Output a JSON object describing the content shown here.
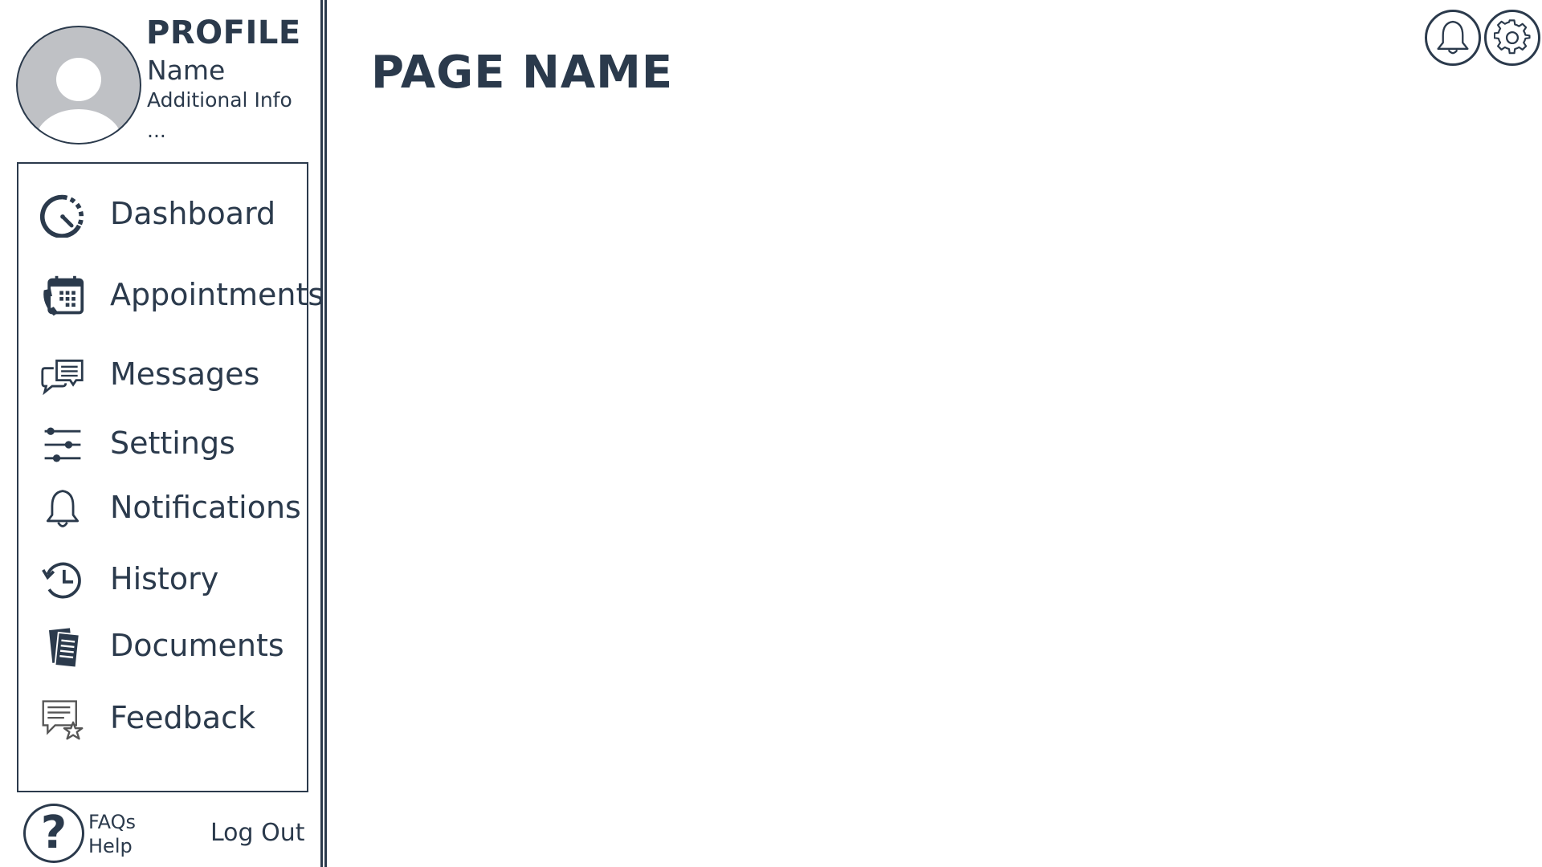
{
  "profile": {
    "heading": "PROFILE",
    "name": "Name",
    "additional_info": "Additional Info",
    "more": "..."
  },
  "sidebar": {
    "items": [
      {
        "label": "Dashboard",
        "icon": "dashboard-gauge-icon"
      },
      {
        "label": "Appointments",
        "icon": "calendar-phone-icon"
      },
      {
        "label": "Messages",
        "icon": "chat-bubbles-icon"
      },
      {
        "label": "Settings",
        "icon": "sliders-icon"
      },
      {
        "label": "Notifications",
        "icon": "bell-icon"
      },
      {
        "label": "History",
        "icon": "history-clock-icon"
      },
      {
        "label": "Documents",
        "icon": "documents-icon"
      },
      {
        "label": "Feedback",
        "icon": "feedback-star-icon"
      }
    ]
  },
  "footer": {
    "help_line1": "FAQs",
    "help_line2": "Help",
    "logout_label": "Log Out",
    "help_icon": "question-mark-icon"
  },
  "main": {
    "page_title": "PAGE NAME"
  },
  "topbar": {
    "icons": [
      "bell-icon",
      "gear-icon"
    ]
  },
  "colors": {
    "primary": "#2b3a4c",
    "avatar_gray": "#bfc1c5",
    "background": "#ffffff"
  }
}
